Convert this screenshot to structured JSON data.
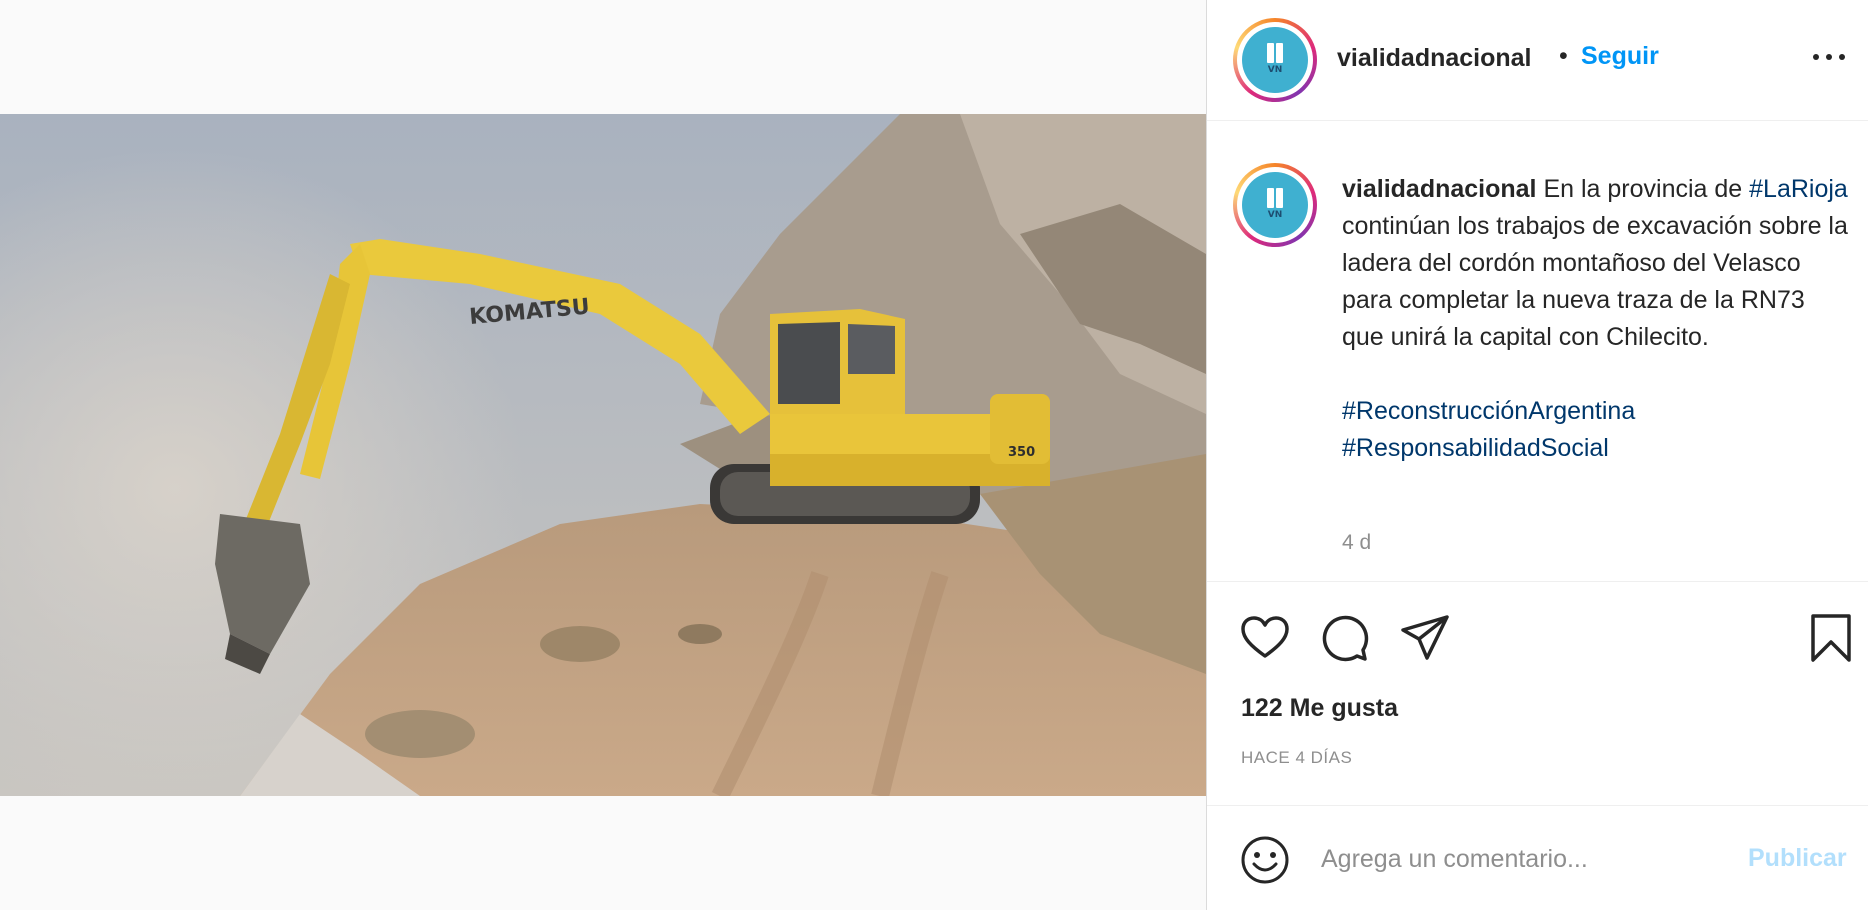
{
  "post": {
    "username": "vialidadnacional",
    "follow_label": "Seguir",
    "separator": "•",
    "avatar_text": "VN",
    "image_brand_text": "KOMATSU",
    "image_model_text": "350"
  },
  "caption": {
    "username": "vialidadnacional",
    "text_1": " En la provincia de ",
    "hashtag_1": "#LaRioja",
    "text_2": " continúan los trabajos de excavación sobre la ladera del cordón montañoso del Velasco para completar la nueva traza de la RN73 que unirá la capital con Chilecito.\n\n",
    "hashtag_2": "#ReconstrucciónArgentina",
    "hashtag_3": "#ResponsabilidadSocial",
    "time_ago": "4 d"
  },
  "actions": {
    "icons": [
      "heart-icon",
      "comment-icon",
      "share-icon",
      "bookmark-icon"
    ],
    "likes": "122 Me gusta",
    "posted": "HACE 4 DÍAS"
  },
  "comment": {
    "placeholder": "Agrega un comentario...",
    "publish_label": "Publicar"
  },
  "colors": {
    "accent": "#0095f6",
    "hashtag": "#00376b",
    "muted": "#8e8e8e",
    "publish_disabled": "#b2dffc",
    "avatar_bg": "#3fb0d0"
  }
}
